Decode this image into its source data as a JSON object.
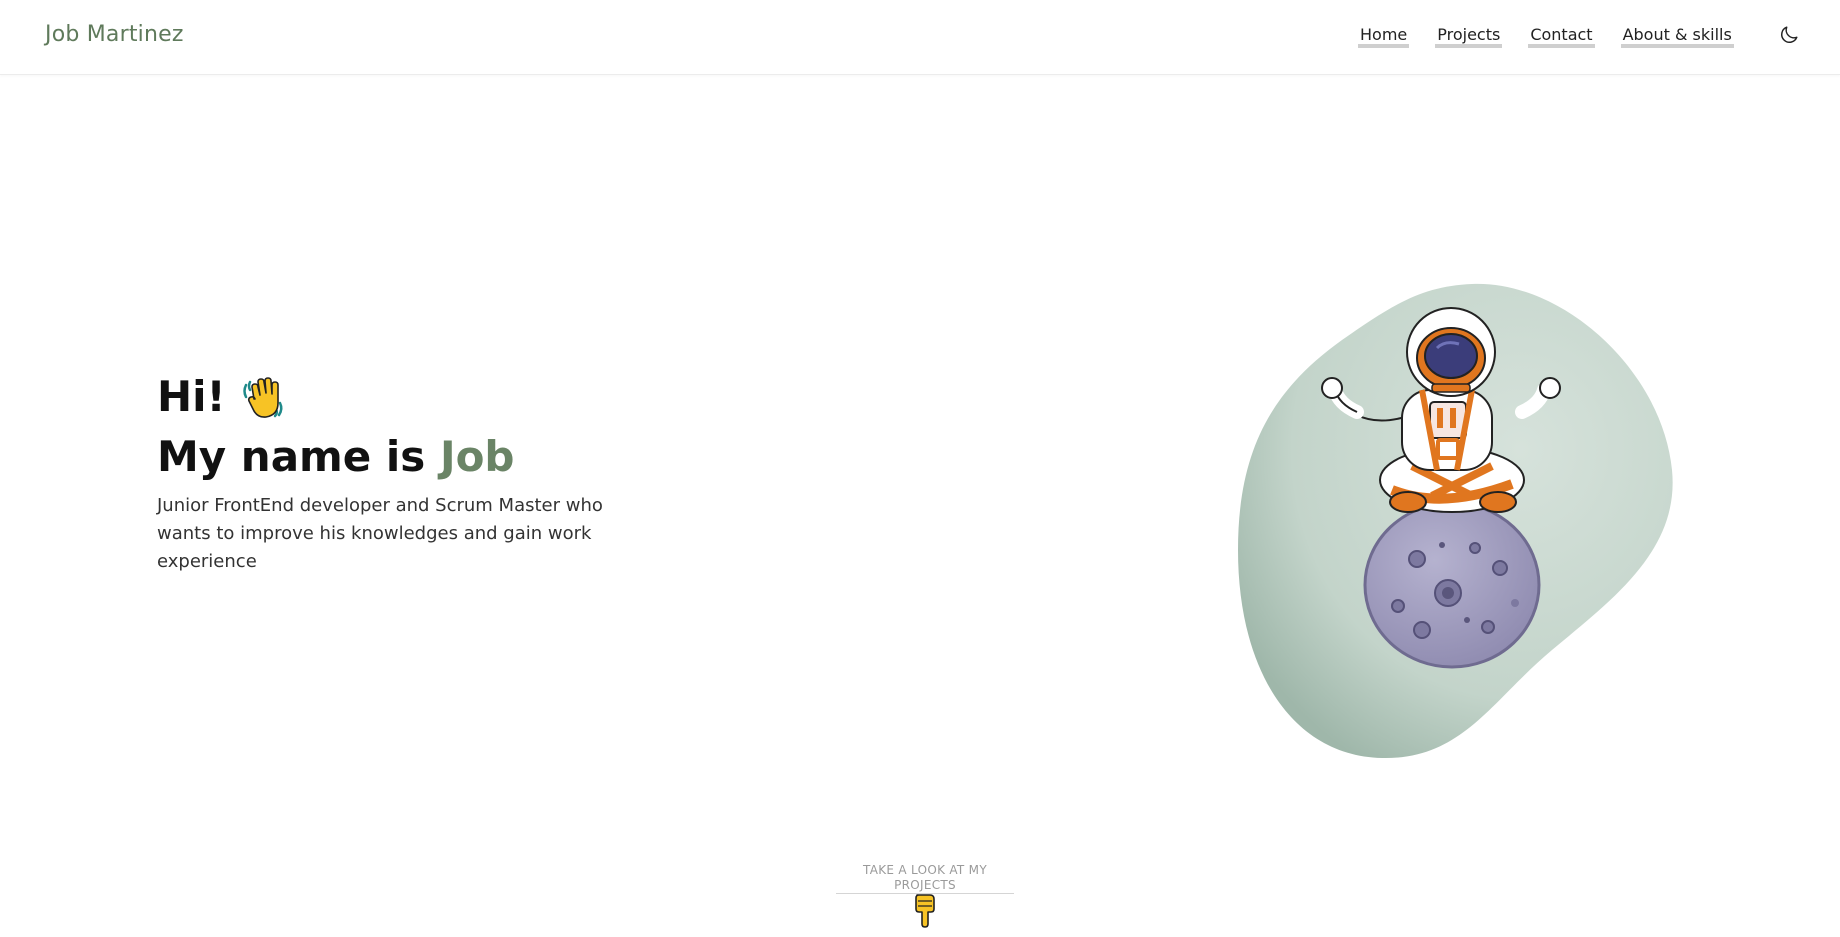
{
  "header": {
    "brand": "Job Martinez",
    "nav": [
      {
        "label": "Home"
      },
      {
        "label": "Projects"
      },
      {
        "label": "Contact"
      },
      {
        "label": "About & skills"
      }
    ],
    "theme_toggle_icon": "moon-icon"
  },
  "hero": {
    "greeting": "Hi!",
    "greeting_icon": "waving-hand-icon",
    "name_prefix": "My name is",
    "name": "Job",
    "tagline": "Junior FrontEnd developer and Scrum Master who wants to improve his knowledges and gain work experience",
    "illustration": "astronaut-on-moon-illustration"
  },
  "cta": {
    "label": "TAKE A LOOK AT MY PROJECTS",
    "icon": "pointing-down-hand-icon"
  },
  "colors": {
    "accent": "#6a8466",
    "blob": "#c9d8cf",
    "underline": "#cfcfcf"
  }
}
